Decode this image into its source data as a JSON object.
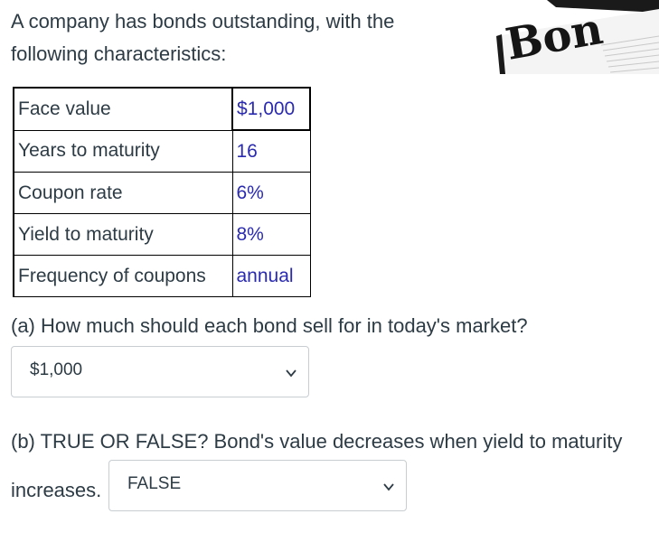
{
  "intro": {
    "line1": "A company has bonds outstanding, with the",
    "line2": "following characteristics:"
  },
  "image": {
    "visible_text": "Bon"
  },
  "table": {
    "rows": [
      {
        "label": "Face value",
        "value": "$1,000"
      },
      {
        "label": "Years to maturity",
        "value": "16"
      },
      {
        "label": "Coupon rate",
        "value": "6%"
      },
      {
        "label": "Yield to maturity",
        "value": "8%"
      },
      {
        "label": "Frequency of coupons",
        "value": "annual"
      }
    ]
  },
  "question_a": {
    "text": "(a) How much should each bond sell for in today's market?",
    "selected": "$1,000",
    "icon": "chevron-down-icon"
  },
  "question_b": {
    "text_line1": "(b) TRUE OR FALSE? Bond's value decreases when yield to maturity",
    "text_line2": "increases.",
    "selected": "FALSE",
    "icon": "chevron-down-icon"
  },
  "colors": {
    "text": "#2d3b45",
    "value_text": "#2a2ab0",
    "border": "#c7cdd1"
  }
}
